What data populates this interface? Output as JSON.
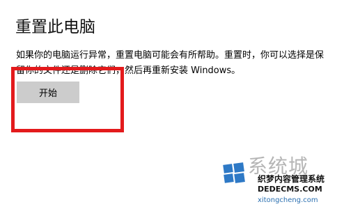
{
  "page": {
    "title": "重置此电脑",
    "description": "如果你的电脑运行异常，重置电脑可能会有所帮助。重置时，你可以选择是保留你的文件还是删除它们，然后再重新安装 Windows。",
    "button_label": "开始"
  },
  "annotation": {
    "color": "#e31a1c"
  },
  "watermark": {
    "brand": "系统城",
    "line1": "织梦内容管理系统",
    "line2": "DEDECMS.COM",
    "domain": "xitongcheng.com"
  }
}
